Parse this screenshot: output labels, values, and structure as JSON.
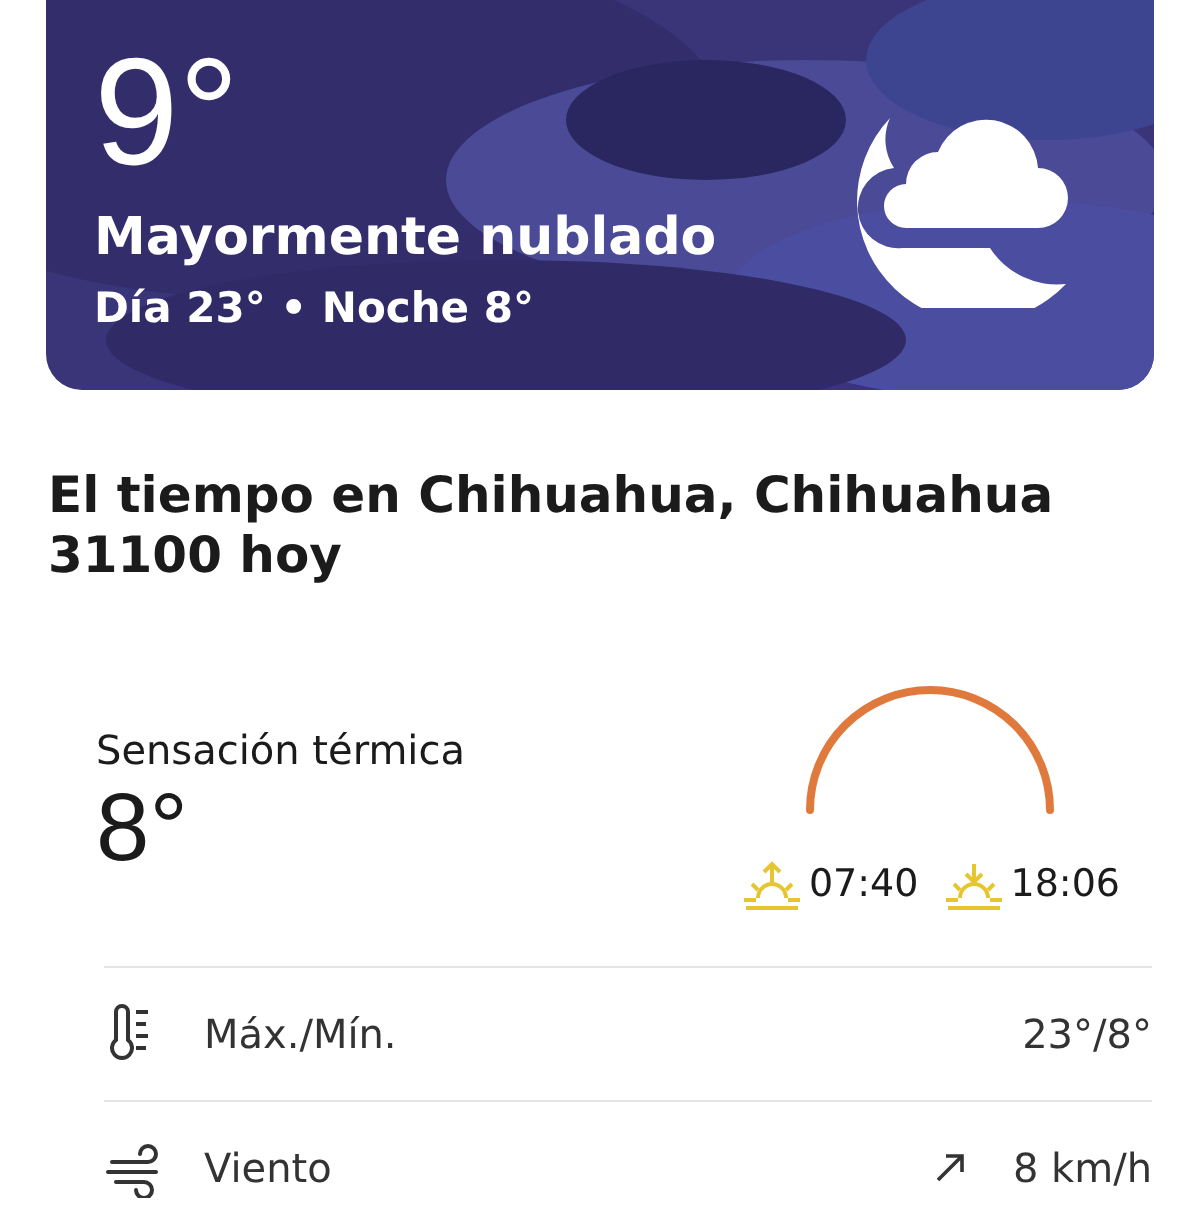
{
  "current": {
    "kind": "picture",
    "temperature": "9°",
    "condition": "Mayormente nublado",
    "day_night": "Día 23° • Noche 8°"
  },
  "heading": "El tiempo en Chihuahua, Chihuahua 31100 hoy",
  "feels_like": {
    "label": "Sensación térmica",
    "value": "8°"
  },
  "sun": {
    "sunrise": "07:40",
    "sunset": "18:06"
  },
  "details": [
    {
      "kind": "temperature",
      "label": "Máx./Mín.",
      "value": "23°/8°"
    },
    {
      "kind": "wind",
      "label": "Viento",
      "value": "8 km/h"
    }
  ]
}
